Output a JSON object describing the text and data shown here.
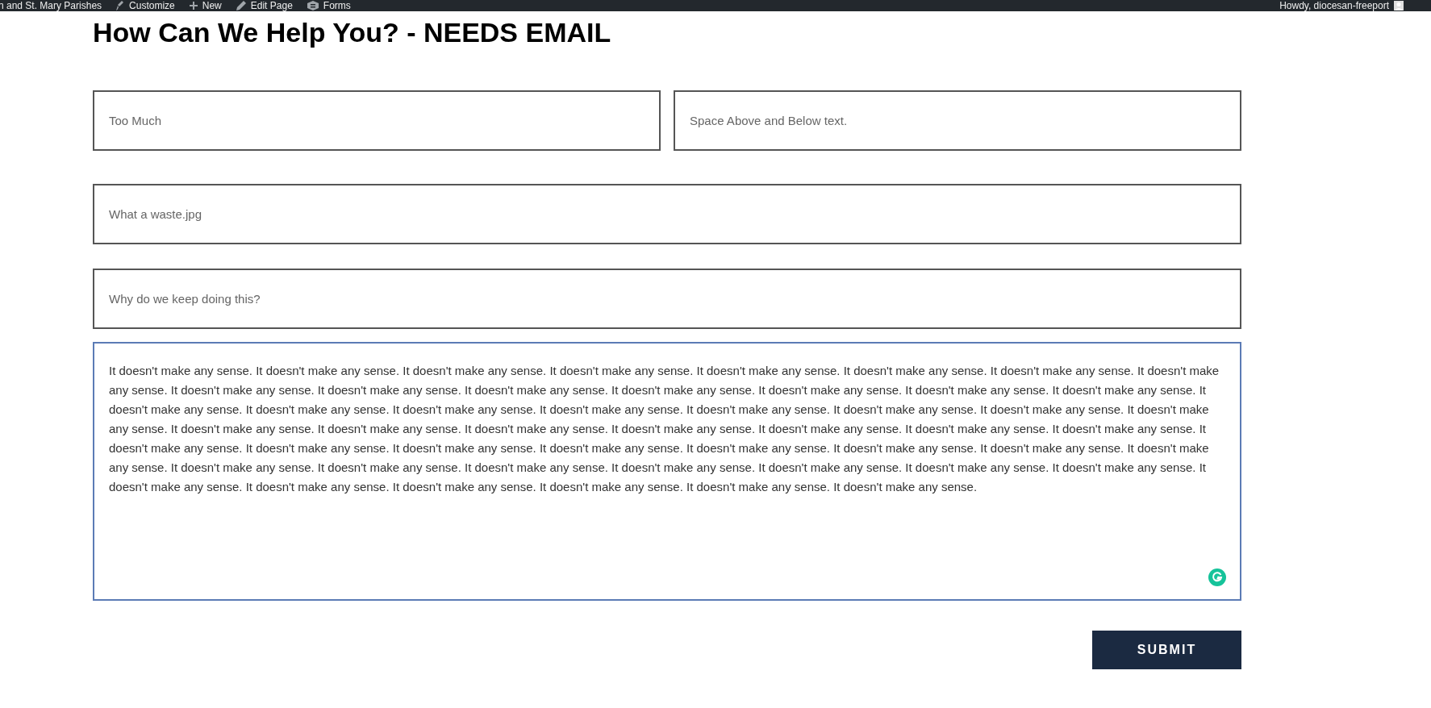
{
  "admin_bar": {
    "site": "n and St. Mary Parishes",
    "items": [
      {
        "kind": "brush",
        "label": "Customize"
      },
      {
        "kind": "plus",
        "label": "New"
      },
      {
        "kind": "pencil",
        "label": "Edit Page"
      },
      {
        "kind": "forms",
        "label": "Forms"
      }
    ],
    "greeting": "Howdy, diocesan-freeport"
  },
  "heading": "How Can We Help You? - NEEDS EMAIL",
  "fields": [
    {
      "placeholder": "Too Much"
    },
    {
      "placeholder": "Space Above and Below text."
    },
    {
      "placeholder": "What a waste.jpg"
    },
    {
      "placeholder": "Why do we keep doing this?"
    }
  ],
  "message": {
    "value": "It doesn't make any sense. It doesn't make any sense. It doesn't make any sense. It doesn't make any sense. It doesn't make any sense. It doesn't make any sense. It doesn't make any sense. It doesn't make any sense. It doesn't make any sense. It doesn't make any sense. It doesn't make any sense. It doesn't make any sense. It doesn't make any sense. It doesn't make any sense. It doesn't make any sense. It doesn't make any sense. It doesn't make any sense. It doesn't make any sense. It doesn't make any sense. It doesn't make any sense. It doesn't make any sense. It doesn't make any sense. It doesn't make any sense. It doesn't make any sense. It doesn't make any sense. It doesn't make any sense. It doesn't make any sense. It doesn't make any sense. It doesn't make any sense. It doesn't make any sense. It doesn't make any sense. It doesn't make any sense. It doesn't make any sense. It doesn't make any sense. It doesn't make any sense. It doesn't make any sense. It doesn't make any sense. It doesn't make any sense. It doesn't make any sense. It doesn't make any sense. It doesn't make any sense. It doesn't make any sense. It doesn't make any sense. It doesn't make any sense. It doesn't make any sense. It doesn't make any sense. It doesn't make any sense. It doesn't make any sense. It doesn't make any sense. It doesn't make any sense. It doesn't make any sense.",
    "focused": true
  },
  "submit": "SUBMIT"
}
